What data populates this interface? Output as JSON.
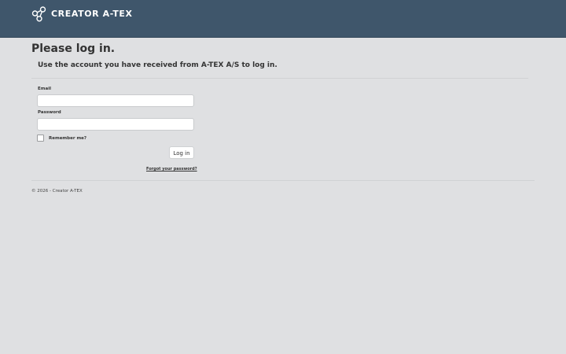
{
  "brand": {
    "name": "CREATOR A-TEX",
    "icon": "share-nodes-icon"
  },
  "page": {
    "title": "Please log in.",
    "subtitle": "Use the account you have received from A-TEX A/S to log in."
  },
  "form": {
    "email_label": "Email",
    "email_value": "",
    "password_label": "Password",
    "password_value": "",
    "remember_label": "Remember me?",
    "remember_checked": false,
    "login_label": "Log in",
    "forgot_label": "Forgot your password?"
  },
  "footer": {
    "text": "© 2026 - Creator A-TEX"
  },
  "colors": {
    "navbar": "#3f566b",
    "background": "#dfe0e2",
    "text": "#333333"
  }
}
